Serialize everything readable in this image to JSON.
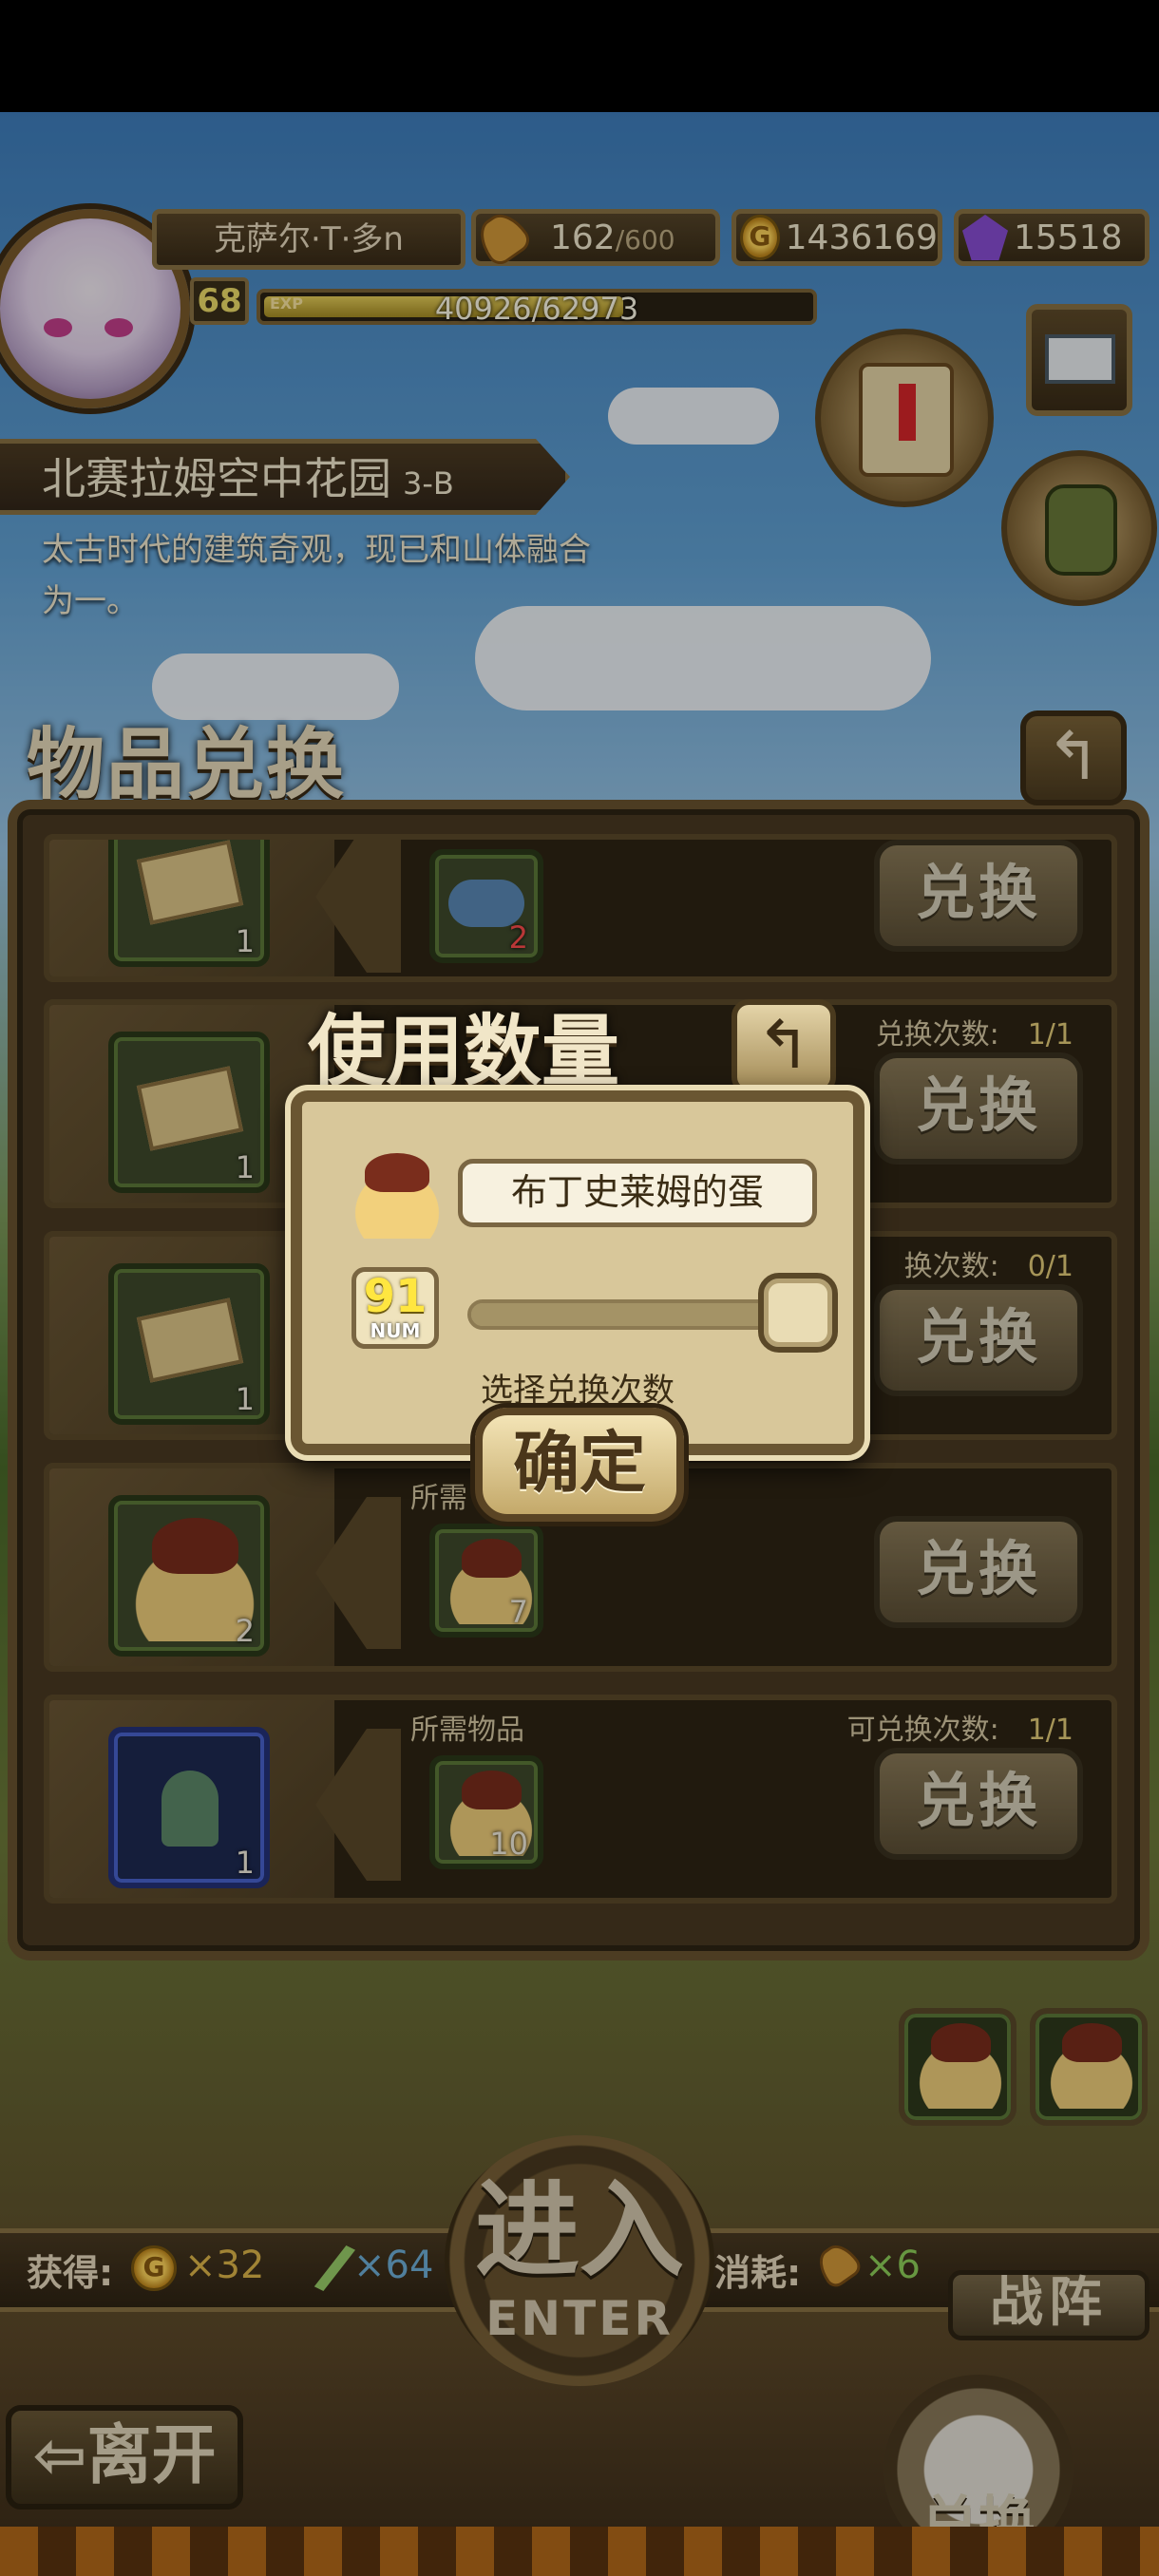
{
  "player": {
    "name": "克萨尔·T·多n",
    "level": "68",
    "exp_label": "EXP",
    "exp_text": "40926/62973",
    "exp_progress": 0.65
  },
  "resources": {
    "stamina": "162",
    "stamina_max": "/600",
    "gold": "1436169",
    "gems": "15518"
  },
  "stage": {
    "name": "北赛拉姆空中花园",
    "code": "3-B",
    "description": "太古时代的建筑奇观，现已和山体融合为一。"
  },
  "exchange_panel": {
    "title": "物品兑换",
    "rows": [
      {
        "reward_qty": "1",
        "cost_qty": "2",
        "header": "",
        "count_label": "",
        "count": "",
        "button": "兑换"
      },
      {
        "reward_qty": "1",
        "cost_qty": "",
        "header": "",
        "count_label": "兑换次数:",
        "count": "1/1",
        "button": "兑换"
      },
      {
        "reward_qty": "1",
        "cost_qty": "",
        "header": "",
        "count_label": "换次数:",
        "count": "0/1",
        "button": "兑换"
      },
      {
        "reward_qty": "2",
        "cost_qty": "7",
        "header": "所需",
        "count_label": "",
        "count": "",
        "button": "兑换"
      },
      {
        "reward_qty": "1",
        "cost_qty": "10",
        "header": "所需物品",
        "count_label": "可兑换次数:",
        "count": "1/1",
        "button": "兑换"
      }
    ]
  },
  "modal": {
    "title": "使用数量",
    "item_name": "布丁史莱姆的蛋",
    "max_value": "91",
    "max_label": "NUM",
    "slider_value": 1.0,
    "hint": "选择兑换次数",
    "confirm": "确定"
  },
  "bottom": {
    "gain_label": "获得:",
    "gain_gold": "×32",
    "gain_feather": "×64",
    "consume_label": "消耗:",
    "consume_stamina": "×6",
    "enter_main": "进入",
    "enter_sub": "ENTER",
    "lineup": "战阵",
    "leave": "离开",
    "exchange": "兑换"
  },
  "colors": {
    "gain_value": "#e0b84a",
    "feather_value": "#6fb0d8",
    "consume_value": "#8fd15a"
  }
}
